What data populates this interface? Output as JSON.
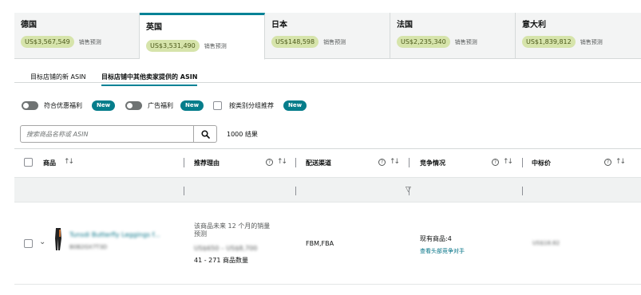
{
  "marketplaces": [
    {
      "name": "德国",
      "amount": "US$3,567,549",
      "label": "销售预测",
      "active": false
    },
    {
      "name": "英国",
      "amount": "US$3,531,490",
      "label": "销售预测",
      "active": true
    },
    {
      "name": "日本",
      "amount": "US$148,598",
      "label": "销售预测",
      "active": false
    },
    {
      "name": "法国",
      "amount": "US$2,235,340",
      "label": "销售预测",
      "active": false
    },
    {
      "name": "意大利",
      "amount": "US$1,839,812",
      "label": "销售预测",
      "active": false
    }
  ],
  "subtabs": {
    "new_asin": "目标店铺的新 ASIN",
    "others_asin": "目标店铺中其他卖家提供的 ASIN"
  },
  "filters": {
    "deal_label": "符合优惠福利",
    "ad_label": "广告福利",
    "group_label": "按类别分组推荐",
    "new_badge": "New"
  },
  "search": {
    "placeholder": "搜索商品名称或 ASIN",
    "results": "1000 结果"
  },
  "table": {
    "headers": {
      "product": "商品",
      "reason": "推荐理由",
      "channel": "配送渠道",
      "competition": "竞争情况",
      "bid": "中标价"
    },
    "rows": [
      {
        "title": "Tunsdi Butterfly Leggings f...",
        "asin": "B0B2GX7T3D",
        "reason_line1": "该商品未来 12 个月的销量",
        "reason_line2": "预测",
        "reason_range": "US$650 – US$8,700",
        "reason_qty": "41 - 271 商品数量",
        "channel": "FBM,FBA",
        "competition": "现有商品:4",
        "competition_link": "查看头部竞争对手",
        "bid": "US$18.82"
      }
    ]
  },
  "colors": {
    "accent": "#008296",
    "badge": "#067d8b",
    "pill": "#d6e4ab",
    "link": "#007185"
  },
  "icons": {
    "search": "magnifier-icon",
    "sort": "sort-arrows-icon",
    "help": "question-circle-icon",
    "filter": "funnel-icon",
    "expand": "chevron-down-icon"
  }
}
